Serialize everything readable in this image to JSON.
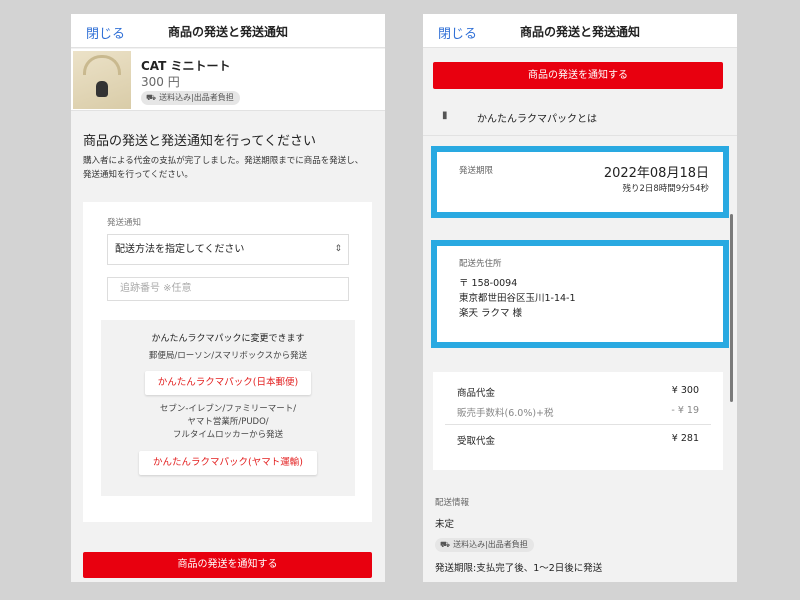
{
  "left": {
    "header": {
      "close": "閉じる",
      "title": "商品の発送と発送通知"
    },
    "item": {
      "name": "CAT ミニトート",
      "price": "300 円",
      "tag": {
        "icon": "truck-icon",
        "text": "送料込み|出品者負担"
      }
    },
    "section": {
      "title": "商品の発送と発送通知を行ってください",
      "desc": "購入者による代金の支払が完了しました。発送期限までに商品を発送し、発送通知を行ってください。"
    },
    "form": {
      "label": "発送通知",
      "select_value": "配送方法を指定してください",
      "tracking_placeholder": "追跡番号 ※任意",
      "rakuma": {
        "title": "かんたんラクマパックに変更できます",
        "note1": "郵便局/ローソン/スマリボックスから発送",
        "btn1": "かんたんラクマパック(日本郵便)",
        "note2_lines": [
          "セブン-イレブン/ファミリーマート/",
          "ヤマト営業所/PUDO/",
          "フルタイムロッカーから発送"
        ],
        "btn2": "かんたんラクマパック(ヤマト運輸)"
      }
    },
    "submit": "商品の発送を通知する"
  },
  "right": {
    "header": {
      "close": "閉じる",
      "title": "商品の発送と発送通知"
    },
    "submit": "商品の発送を通知する",
    "rakuma_link": {
      "icon": "book-icon",
      "text": "かんたんラクマパックとは"
    },
    "deadline": {
      "label": "発送期限",
      "date": "2022年08月18日",
      "remaining": "残り2日8時間9分54秒"
    },
    "address": {
      "label": "配送先住所",
      "postal": "〒 158-0094",
      "line": "東京都世田谷区玉川1-14-1",
      "name": "楽天 ラクマ 様"
    },
    "prices": [
      {
        "label": "商品代金",
        "value": "¥ 300",
        "muted": false
      },
      {
        "label": "販売手数料(6.0%)+税",
        "value": "- ¥ 19",
        "muted": true
      },
      {
        "label": "受取代金",
        "value": "¥ 281",
        "muted": false
      }
    ],
    "shipping": {
      "label": "配送情報",
      "status": "未定",
      "tag": {
        "icon": "truck-icon",
        "text": "送料込み|出品者負担"
      },
      "deadline_text": "発送期限:支払完了後、1〜2日後に発送"
    }
  },
  "colors": {
    "accent_blue": "#2f6fd6",
    "brand_red": "#e8000f",
    "highlight": "#29a9e1"
  }
}
